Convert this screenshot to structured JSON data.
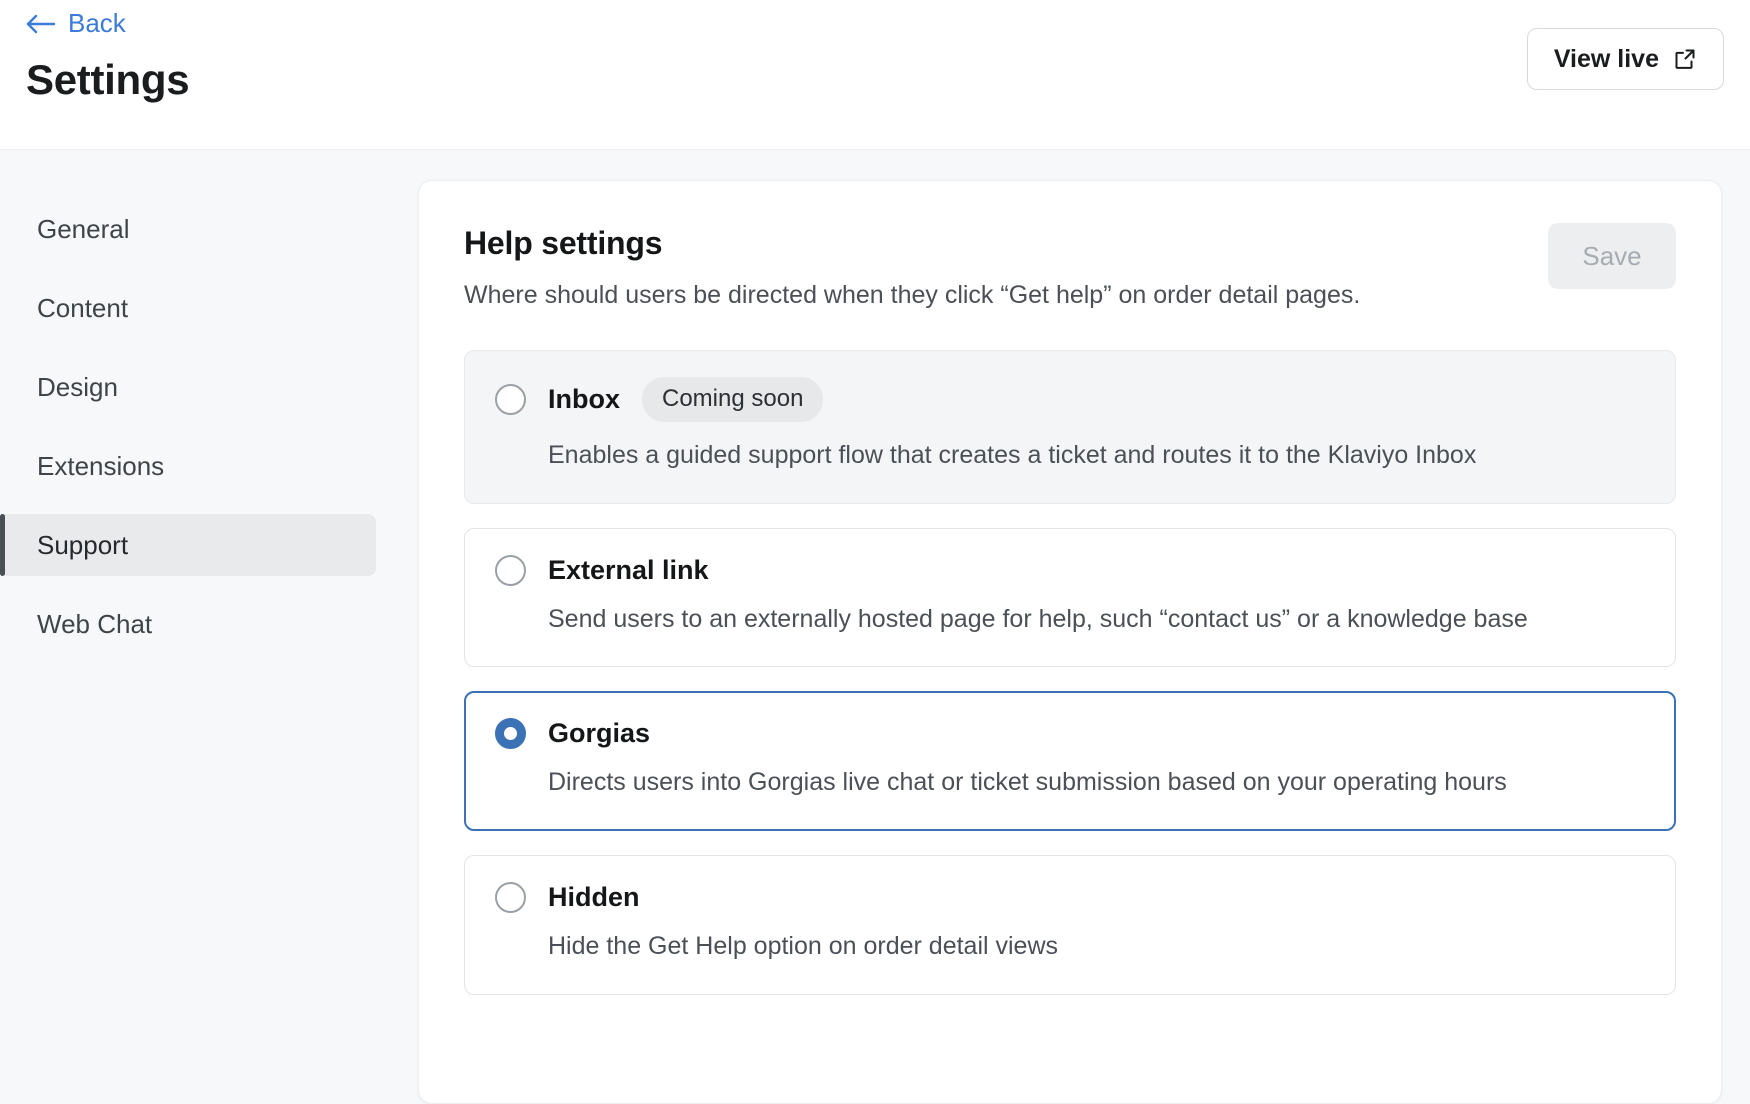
{
  "header": {
    "back_label": "Back",
    "back_icon": "arrow-left-icon",
    "title": "Settings",
    "view_live_label": "View live",
    "view_live_icon": "external-link-icon"
  },
  "sidebar": {
    "items": [
      {
        "label": "General",
        "active": false
      },
      {
        "label": "Content",
        "active": false
      },
      {
        "label": "Design",
        "active": false
      },
      {
        "label": "Extensions",
        "active": false
      },
      {
        "label": "Support",
        "active": true
      },
      {
        "label": "Web Chat",
        "active": false
      }
    ]
  },
  "panel": {
    "title": "Help settings",
    "subtitle": "Where should users be directed when they click “Get help” on order detail pages.",
    "save_label": "Save",
    "save_disabled": true,
    "options": [
      {
        "label": "Inbox",
        "badge": "Coming soon",
        "description": "Enables a guided support flow that creates a ticket and routes it to the Klaviyo Inbox",
        "selected": false,
        "muted": true
      },
      {
        "label": "External link",
        "badge": "",
        "description": "Send users to an externally hosted page for help, such “contact us” or a knowledge base",
        "selected": false,
        "muted": false
      },
      {
        "label": "Gorgias",
        "badge": "",
        "description": "Directs users into Gorgias live chat or ticket submission based on your operating hours",
        "selected": true,
        "muted": false
      },
      {
        "label": "Hidden",
        "badge": "",
        "description": "Hide the Get Help option on order detail views",
        "selected": false,
        "muted": false
      }
    ]
  },
  "colors": {
    "link": "#3d7bd9",
    "accent_selected": "#3b72b5",
    "page_bg": "#f7f8fa",
    "active_nav_bg": "#e8eaec",
    "active_nav_bar": "#4a4f55",
    "badge_bg": "#e6e8ea",
    "save_disabled_bg": "#eceef0",
    "save_disabled_text": "#a7acb3"
  }
}
